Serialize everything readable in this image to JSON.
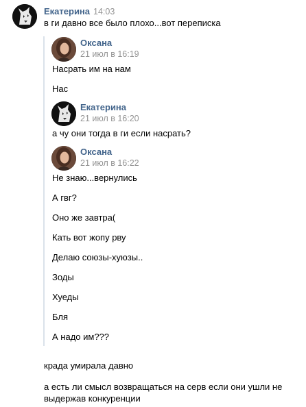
{
  "main": {
    "author": "Екатерина",
    "time": "14:03",
    "text": "в ги давно все было плохо...вот переписка"
  },
  "forwarded": [
    {
      "author": "Оксана",
      "time": "21 июл в 16:19",
      "lines": [
        "Насрать им на нам",
        "Нас"
      ]
    },
    {
      "author": "Екатерина",
      "time": "21 июл в 16:20",
      "lines": [
        "а чу они тогда в ги если насрать?"
      ]
    },
    {
      "author": "Оксана",
      "time": "21 июл в 16:22",
      "lines": [
        "Не знаю...вернулись",
        "А гвг?",
        "Оно же завтра(",
        "Кать вот жопу рву",
        "Делаю союзы-хуюзы..",
        "Зоды",
        "Хуеды",
        "Бля",
        "А надо им???"
      ]
    }
  ],
  "after": [
    "крада умирала давно",
    "а есть ли смысл возвращаться на серв если они ушли не",
    "выдержав конкуренции"
  ],
  "colors": {
    "author": "#42648b",
    "time": "#939393",
    "forward_line": "#dae2ea"
  }
}
